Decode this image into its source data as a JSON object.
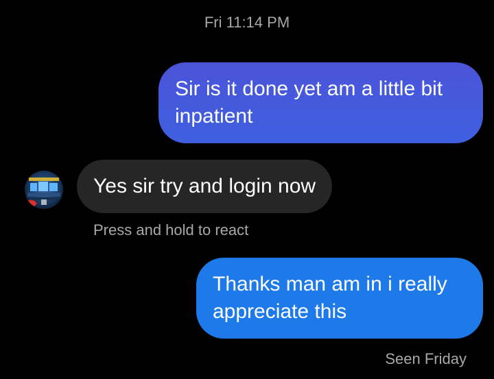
{
  "conversation": {
    "timestamp": "Fri 11:14 PM",
    "messages": [
      {
        "direction": "outgoing",
        "text": "Sir is it done yet am a little bit inpatient"
      },
      {
        "direction": "incoming",
        "text": "Yes sir try and login now"
      },
      {
        "direction": "outgoing",
        "text": "Thanks man am in i really appreciate this"
      }
    ],
    "react_hint": "Press and hold to react",
    "seen_status": "Seen Friday"
  },
  "colors": {
    "background": "#000000",
    "outgoing_bubble_top": "#4b54d9",
    "outgoing_bubble_latest": "#1d7ae8",
    "incoming_bubble": "#262626",
    "meta_text": "#a8a8a8"
  },
  "icons": {
    "avatar": "contact-avatar-icon"
  }
}
